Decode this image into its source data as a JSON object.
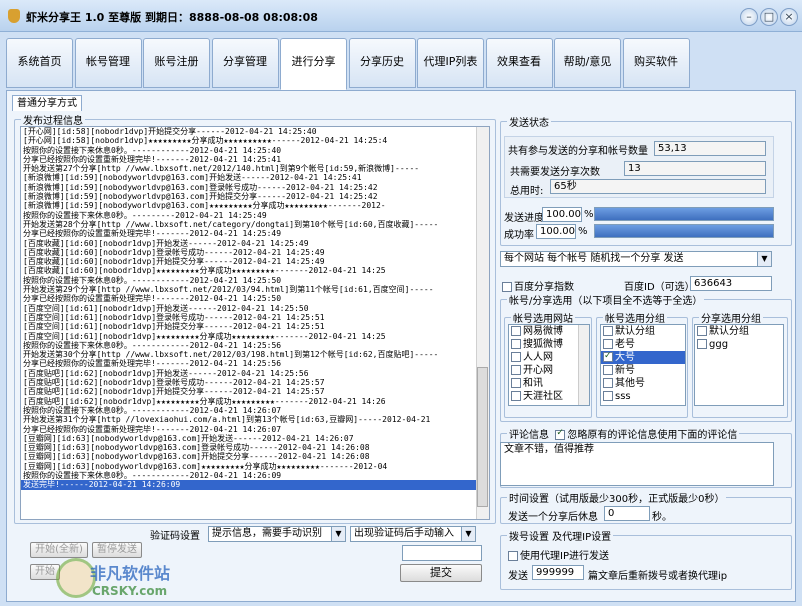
{
  "window": {
    "title": "虾米分享王 1.0 至尊版 到期日：8888-08-08 08:08:08"
  },
  "tabs": [
    "系统首页",
    "帐号管理",
    "账号注册",
    "分享管理",
    "进行分享",
    "分享历史",
    "代理IP列表",
    "效果查看",
    "帮助/意见",
    "购买软件"
  ],
  "active_tab": "进行分享",
  "subtab": "普通分享方式",
  "log": {
    "legend": "发布过程信息",
    "lines": [
      "[开心网][id:58][nobodr1dvp]开始提交分享------2012-04-21 14:25:40",
      "[开心网][id:58][nobodr1dvp]★★★★★★★★★分享成功★★★★★★★★★★------2012-04-21 14:25:4",
      "按照你的设置接下来休息0秒。------------2012-04-21 14:25:40",
      "分享已经按照你的设置重新处理完毕!-------2012-04-21 14:25:41",
      "开始发送第27个分享[http //www.lbxsoft.net/2012/140.html]到第9个帐号[id:59,新浪微博]-----",
      "[新浪微博][id:59][nobodyworldvp@163.com]开始发送------2012-04-21 14:25:41",
      "[新浪微博][id:59][nobodyworldvp@163.com]登录帐号成功------2012-04-21 14:25:42",
      "[新浪微博][id:59][nobodyworldvp@163.com]开始提交分享------2012-04-21 14:25:42",
      "[新浪微博][id:59][nobodyworldvp@163.com]★★★★★★★★★分享成功★★★★★★★★★-------2012-",
      "按照你的设置接下来休息0秒。---------2012-04-21 14:25:49",
      "开始发送第28个分享[http //www.lbxsoft.net/category/dongtai]到第10个帐号[id:60,百度收藏]-----",
      "分享已经按照你的设置重新处理完毕!-------2012-04-21 14:25:49",
      "[百度收藏][id:60][nobodr1dvp]开始发送------2012-04-21 14:25:49",
      "[百度收藏][id:60][nobodr1dvp]登录帐号成功------2012-04-21 14:25:49",
      "[百度收藏][id:60][nobodr1dvp]开始提交分享------2012-04-21 14:25:49",
      "[百度收藏][id:60][nobodr1dvp]★★★★★★★★★分享成功★★★★★★★★★-------2012-04-21 14:25",
      "按照你的设置接下来休息0秒。------------2012-04-21 14:25:50",
      "开始发送第29个分享[http //www.lbxsoft.net/2012/03/94.html]到第11个帐号[id:61,百度空间]-----",
      "分享已经按照你的设置重新处理完毕!-------2012-04-21 14:25:50",
      "[百度空间][id:61][nobodr1dvp]开始发送------2012-04-21 14:25:50",
      "[百度空间][id:61][nobodr1dvp]登录帐号成功------2012-04-21 14:25:51",
      "[百度空间][id:61][nobodr1dvp]开始提交分享------2012-04-21 14:25:51",
      "[百度空间][id:61][nobodr1dvp]★★★★★★★★★分享成功★★★★★★★★★-------2012-04-21 14:25",
      "按照你的设置接下来休息0秒。------------2012-04-21 14:25:56",
      "开始发送第30个分享[http //www.lbxsoft.net/2012/03/198.html]到第12个帐号[id:62,百度贴吧]-----",
      "分享已经按照你的设置重新处理完毕!-------2012-04-21 14:25:56",
      "[百度贴吧][id:62][nobodr1dvp]开始发送------2012-04-21 14:25:56",
      "[百度贴吧][id:62][nobodr1dvp]登录帐号成功------2012-04-21 14:25:57",
      "[百度贴吧][id:62][nobodr1dvp]开始提交分享------2012-04-21 14:25:57",
      "[百度贴吧][id:62][nobodr1dvp]★★★★★★★★★分享成功★★★★★★★★★-------2012-04-21 14:26",
      "按照你的设置接下来休息0秒。------------2012-04-21 14:26:07",
      "开始发送第31个分享[http //lovexiaohui.com/a.html]到第13个帐号[id:63,豆瓣网]-----2012-04-21",
      "分享已经按照你的设置重新处理完毕!-------2012-04-21 14:26:07",
      "[豆瓣网][id:63][nobodyworldvp@163.com]开始发送------2012-04-21 14:26:07",
      "[豆瓣网][id:63][nobodyworldvp@163.com]登录帐号成功------2012-04-21 14:26:08",
      "[豆瓣网][id:63][nobodyworldvp@163.com]开始提交分享------2012-04-21 14:26:08",
      "[豆瓣网][id:63][nobodyworldvp@163.com]★★★★★★★★★分享成功★★★★★★★★★-------2012-04",
      "按照你的设置接下来休息0秒。------------2012-04-21 14:26:09",
      "发送完毕!------2012-04-21 14:26:09"
    ]
  },
  "buttons": {
    "start": "开始(全新)",
    "pause": "暂停发送",
    "submit": "提交",
    "next": "开始"
  },
  "captcha": {
    "label": "验证码设置",
    "mode": "提示信息，需要手动识别",
    "after": "出现验证码后手动输入"
  },
  "status": {
    "legend": "发送状态",
    "total_label": "共有参与发送的分享和帐号数量",
    "total_value": "53,13",
    "need_label": "共需要发送分享次数",
    "need_value": "13",
    "time_label": "总用时:",
    "time_value": "65秒",
    "progress_label": "发送进度",
    "progress_value": "100.00",
    "progress_fraction": 1.0,
    "success_label": "成功率",
    "success_value": "100.00",
    "success_fraction": 1.0,
    "percent": "%"
  },
  "strategy": {
    "value": "每个网站 每个帐号 随机找一个分享 发送"
  },
  "baidu": {
    "index_label": "百度分享指数",
    "id_label": "百度ID（可选）",
    "id_value": "636643"
  },
  "account": {
    "legend": "帐号/分享选用（以下项目全不选等于全选）",
    "sites_legend": "帐号选用网站",
    "sites": [
      "网易微博",
      "搜狐微博",
      "人人网",
      "开心网",
      "和讯",
      "天涯社区"
    ],
    "groups_legend": "帐号选用分组",
    "groups": [
      {
        "name": "默认分组",
        "checked": false
      },
      {
        "name": "老号",
        "checked": false
      },
      {
        "name": "大号",
        "checked": true
      },
      {
        "name": "新号",
        "checked": false
      },
      {
        "name": "其他号",
        "checked": false
      },
      {
        "name": "sss",
        "checked": false
      }
    ],
    "share_groups_legend": "分享选用分组",
    "share_groups": [
      "默认分组",
      "ggg"
    ]
  },
  "comment": {
    "legend": "评论信息",
    "override_label": "忽略原有的评论信息使用下面的评论信",
    "text": "文章不错，值得推荐"
  },
  "timing": {
    "legend": "时间设置（试用版最少300秒，正式版最少0秒）",
    "rest_label": "发送一个分享后休息",
    "rest_value": "0",
    "unit": "秒。"
  },
  "dial": {
    "legend": "拨号设置 及代理IP设置",
    "proxy_label": "使用代理IP进行发送",
    "send_label": "发送",
    "send_value": "999999",
    "desc": "篇文章后重新拨号或者换代理ip"
  },
  "watermark": {
    "cn": "非凡软件站",
    "en": "CRSKY.com"
  }
}
